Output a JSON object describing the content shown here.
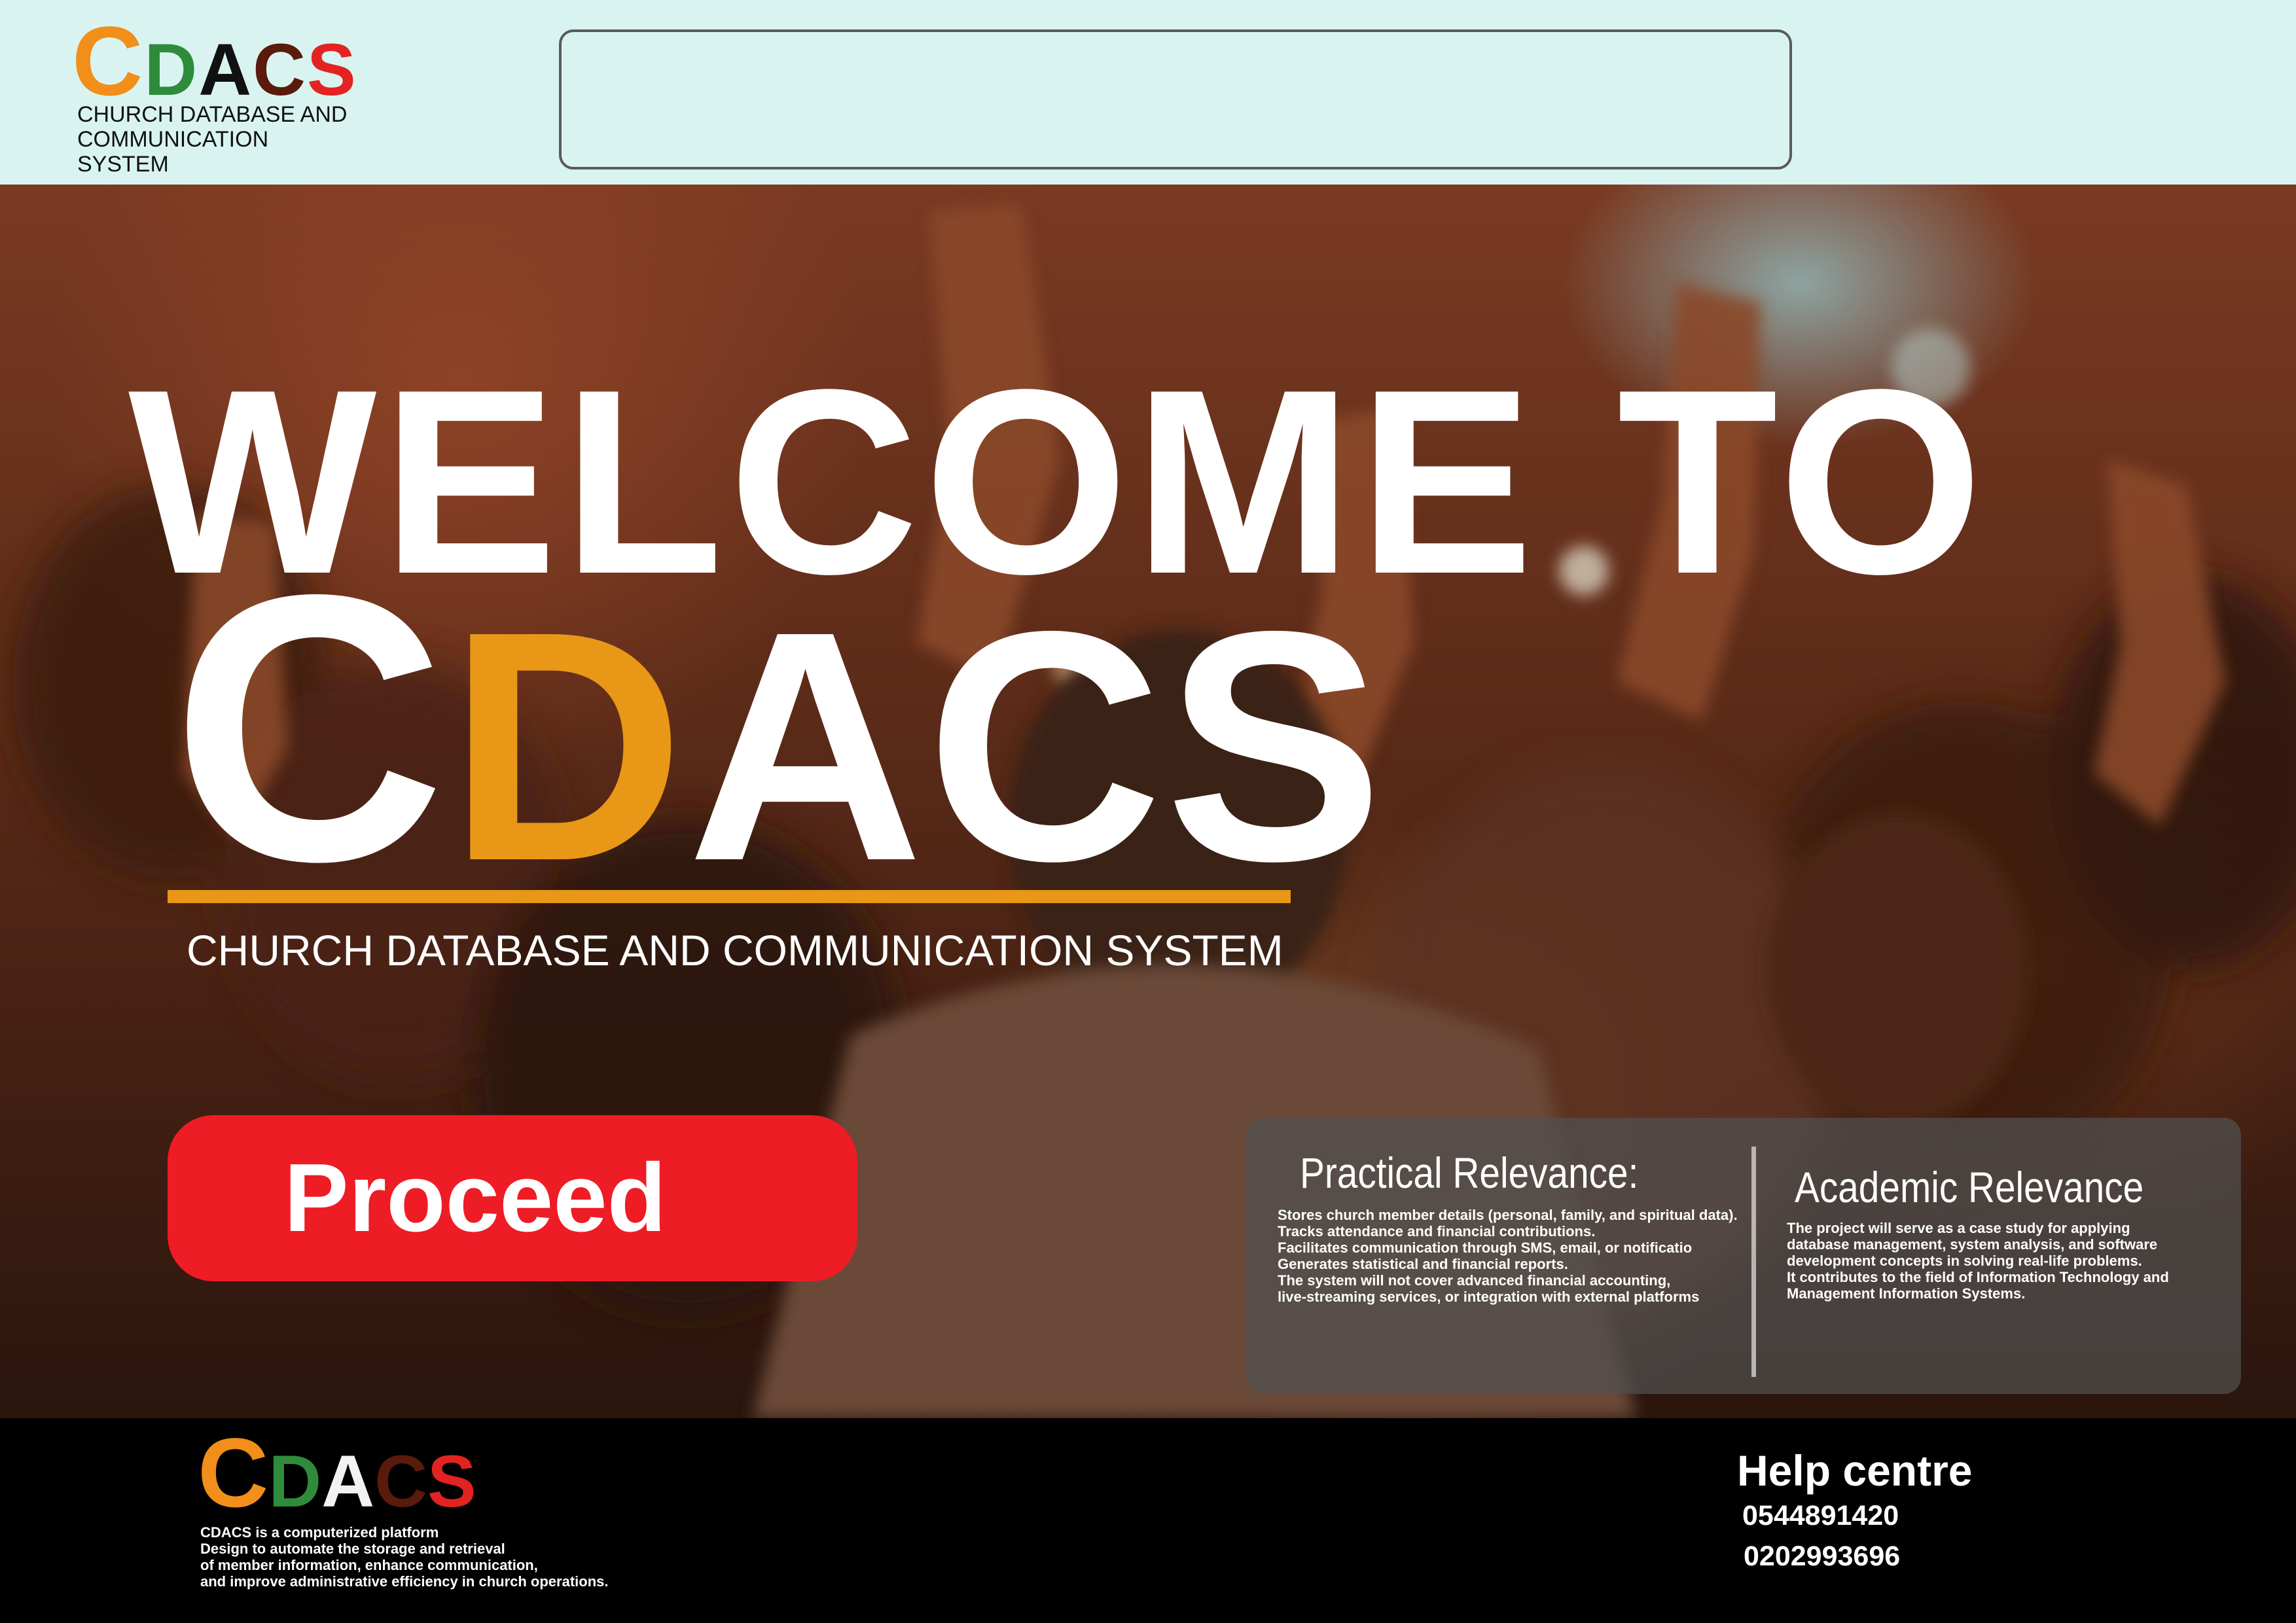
{
  "colors": {
    "header_bg": "#d9f4f0",
    "accent_orange": "#e99717",
    "proceed_red": "#ee1c25",
    "logo_c": "#f18f1a",
    "logo_d": "#2e8b3c",
    "logo_a": "#111111",
    "logo_c2": "#5a1a0c",
    "logo_s": "#e32322",
    "footer_logo_a": "#f2f2f2"
  },
  "header": {
    "logo": {
      "letters": [
        "C",
        "D",
        "A",
        "C",
        "S"
      ],
      "subtitle_lines": [
        "CHURCH DATABASE AND",
        "COMMUNICATION",
        "SYSTEM"
      ]
    },
    "search": {
      "placeholder": "",
      "value": ""
    }
  },
  "hero": {
    "welcome": "WELCOME TO",
    "brand_letters": [
      "C",
      "D",
      "ACS"
    ],
    "tagline": "CHURCH DATABASE AND COMMUNICATION SYSTEM",
    "proceed_label": "Proceed",
    "practical": {
      "title": "Practical Relevance:",
      "lines": [
        "Stores church member details (personal, family, and spiritual data).",
        "Tracks attendance and financial contributions.",
        "Facilitates communication through SMS, email, or notificatio",
        "Generates statistical and financial reports.",
        "The system will not cover advanced financial accounting,",
        "live-streaming services, or integration with external platforms"
      ]
    },
    "academic": {
      "title": "Academic  Relevance",
      "lines": [
        "The project will serve as a case study for applying",
        "database management, system analysis, and software",
        "development concepts in solving real-life problems.",
        "It contributes to the field of Information Technology and",
        "Management Information Systems."
      ]
    }
  },
  "footer": {
    "logo_letters": [
      "C",
      "D",
      "A",
      "C",
      "S"
    ],
    "about_lines": [
      "CDACS is a computerized platform",
      "Design to automate the storage and retrieval",
      "of member information, enhance communication,",
      "and improve administrative efficiency in church operations."
    ],
    "help_title": "Help centre",
    "phones": [
      "0544891420",
      "0202993696"
    ]
  }
}
